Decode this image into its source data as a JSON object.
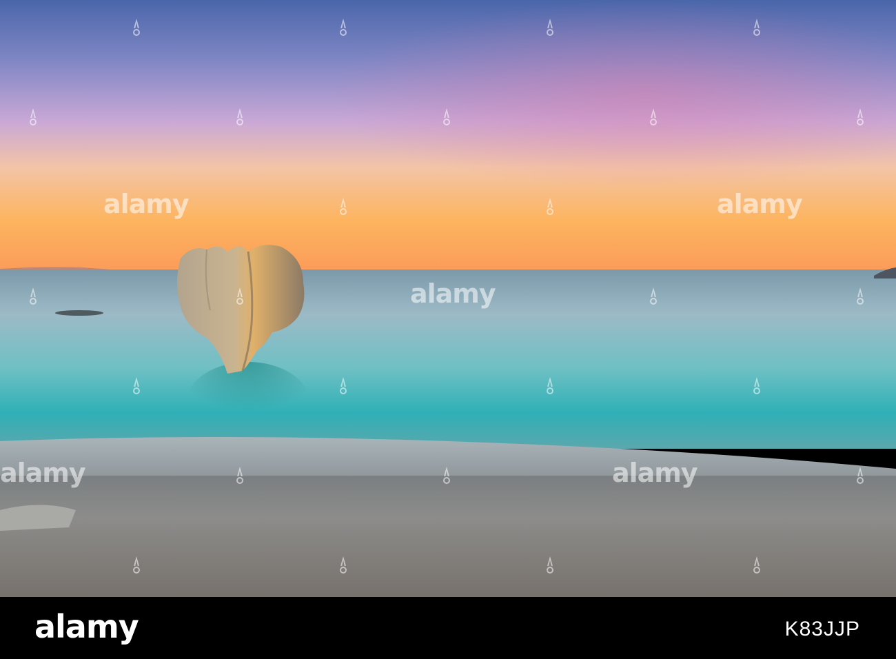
{
  "image": {
    "description_colors": {
      "sky_top": "#4a66a8",
      "sky_mid": "#c7a6d8",
      "sky_horizon": "#fdb25a",
      "sea_far": "#8fb4c4",
      "sea_near": "#2fb1b7",
      "beach": "#8a8a8a"
    }
  },
  "watermarks": {
    "text": "alamy"
  },
  "footer": {
    "logo": "alamy",
    "image_id": "K83JJP"
  }
}
